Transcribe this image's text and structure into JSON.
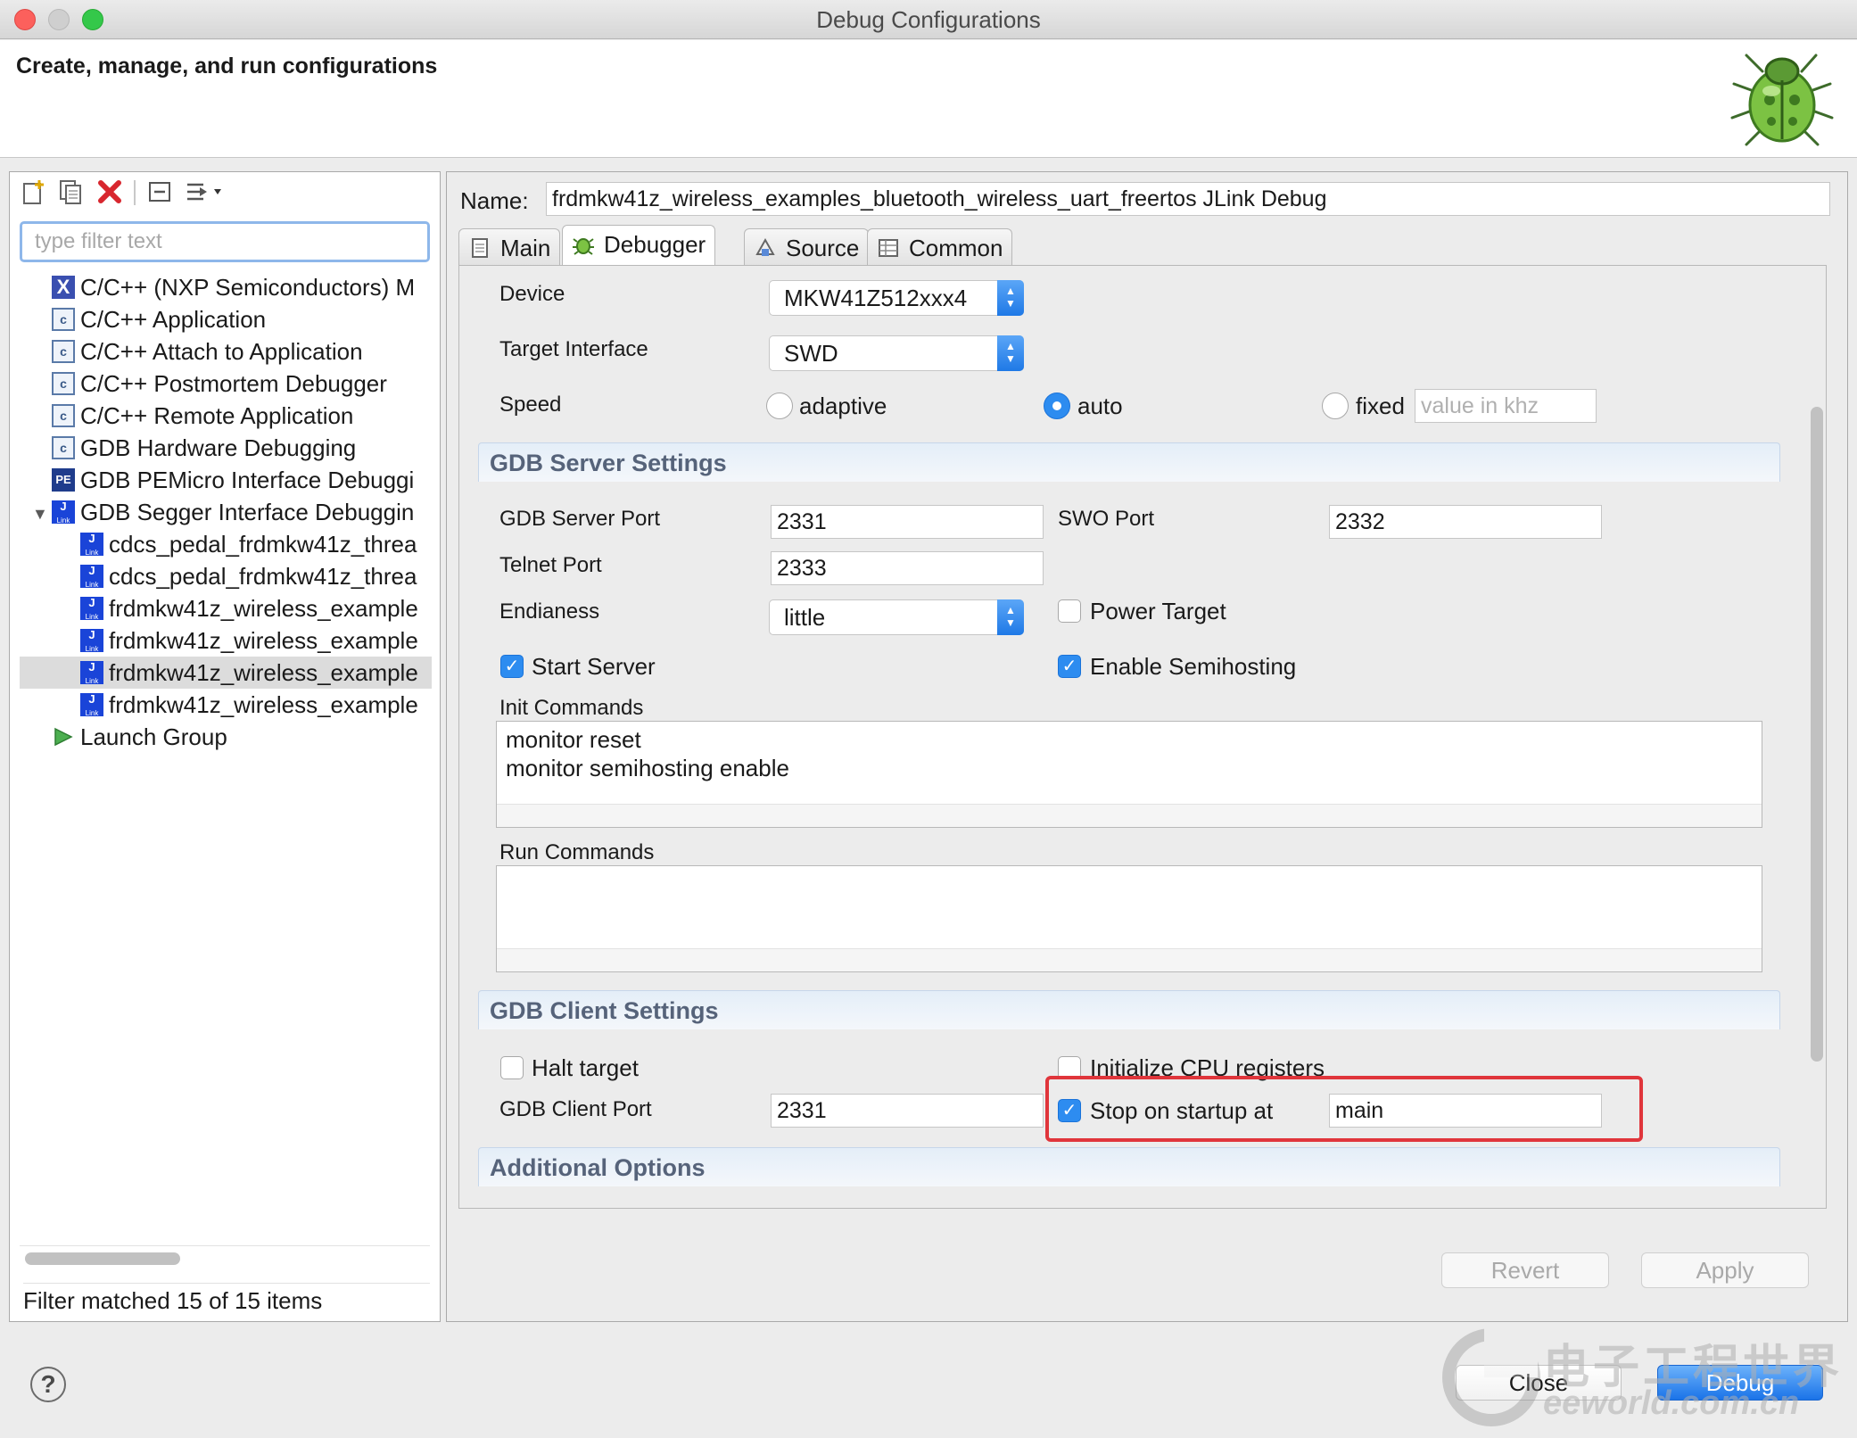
{
  "window": {
    "title": "Debug Configurations",
    "banner_text": "Create, manage, and run configurations"
  },
  "left": {
    "filter_placeholder": "type filter text",
    "filter_value": "",
    "tree": [
      {
        "label": "C/C++ (NXP Semiconductors) M",
        "icon": "nxp-x-icon",
        "glyph": "X",
        "level": 0
      },
      {
        "label": "C/C++ Application",
        "icon": "c-app-icon",
        "glyph": "c",
        "level": 0
      },
      {
        "label": "C/C++ Attach to Application",
        "icon": "c-app-icon",
        "glyph": "c",
        "level": 0
      },
      {
        "label": "C/C++ Postmortem Debugger",
        "icon": "c-app-icon",
        "glyph": "c",
        "level": 0
      },
      {
        "label": "C/C++ Remote Application",
        "icon": "c-app-icon",
        "glyph": "c",
        "level": 0
      },
      {
        "label": "GDB Hardware Debugging",
        "icon": "c-app-icon",
        "glyph": "c",
        "level": 0
      },
      {
        "label": "GDB PEMicro Interface Debuggi",
        "icon": "pemicro-icon",
        "glyph": "PE",
        "level": 0
      },
      {
        "label": "GDB Segger Interface Debuggin",
        "icon": "jlink-icon",
        "glyph": "J",
        "level": 0,
        "expanded": true
      },
      {
        "label": "cdcs_pedal_frdmkw41z_threa",
        "icon": "jlink-icon",
        "glyph": "J",
        "level": 1
      },
      {
        "label": "cdcs_pedal_frdmkw41z_threa",
        "icon": "jlink-icon",
        "glyph": "J",
        "level": 1
      },
      {
        "label": "frdmkw41z_wireless_example",
        "icon": "jlink-icon",
        "glyph": "J",
        "level": 1
      },
      {
        "label": "frdmkw41z_wireless_example",
        "icon": "jlink-icon",
        "glyph": "J",
        "level": 1
      },
      {
        "label": "frdmkw41z_wireless_example",
        "icon": "jlink-icon",
        "glyph": "J",
        "level": 1,
        "selected": true
      },
      {
        "label": "frdmkw41z_wireless_example",
        "icon": "jlink-icon",
        "glyph": "J",
        "level": 1
      },
      {
        "label": "Launch Group",
        "icon": "launch-group-icon",
        "glyph": "▶",
        "level": 0
      }
    ],
    "status": "Filter matched 15 of 15 items"
  },
  "config": {
    "name_label": "Name:",
    "name_value": "frdmkw41z_wireless_examples_bluetooth_wireless_uart_freertos JLink Debug",
    "tabs": [
      {
        "label": "Main",
        "icon": "document-icon",
        "active": false
      },
      {
        "label": "Debugger",
        "icon": "bug-icon",
        "active": true
      },
      {
        "label": "Source",
        "icon": "source-icon",
        "active": false
      },
      {
        "label": "Common",
        "icon": "common-icon",
        "active": false
      }
    ]
  },
  "debugger": {
    "device_label": "Device",
    "device_value": "MKW41Z512xxx4",
    "interface_label": "Target Interface",
    "interface_value": "SWD",
    "speed_label": "Speed",
    "speed_options": [
      "adaptive",
      "auto",
      "fixed"
    ],
    "speed_selected": "auto",
    "speed_khz_placeholder": "value in khz",
    "server": {
      "header": "GDB Server Settings",
      "server_port_label": "GDB Server Port",
      "server_port_value": "2331",
      "swo_port_label": "SWO Port",
      "swo_port_value": "2332",
      "telnet_port_label": "Telnet Port",
      "telnet_port_value": "2333",
      "endianess_label": "Endianess",
      "endianess_value": "little",
      "power_target_label": "Power Target",
      "power_target_checked": false,
      "start_server_label": "Start Server",
      "start_server_checked": true,
      "semihosting_label": "Enable Semihosting",
      "semihosting_checked": true,
      "init_commands_label": "Init Commands",
      "init_commands": [
        "monitor reset",
        "monitor semihosting enable"
      ],
      "run_commands_label": "Run Commands",
      "run_commands": []
    },
    "client": {
      "header": "GDB Client Settings",
      "halt_label": "Halt target",
      "halt_checked": false,
      "init_cpu_label": "Initialize CPU registers",
      "init_cpu_checked": false,
      "client_port_label": "GDB Client Port",
      "client_port_value": "2331",
      "stop_label": "Stop on startup at",
      "stop_checked": true,
      "stop_value": "main"
    },
    "additional_header": "Additional Options"
  },
  "buttons": {
    "revert": "Revert",
    "apply": "Apply",
    "close": "Close",
    "debug": "Debug"
  },
  "watermark": {
    "line1": "电子工程世界",
    "line2": "eeworld.com.cn"
  }
}
